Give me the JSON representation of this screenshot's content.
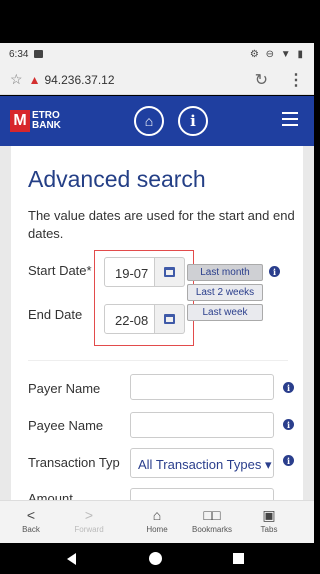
{
  "status": {
    "time": "6:34",
    "icons": "⚙ ⊖ ▼ ▮"
  },
  "browser": {
    "url": "94.236.37.12"
  },
  "header": {
    "logo_mark": "M",
    "logo_line1": "ETRO",
    "logo_line2": "BANK",
    "info_glyph": "i"
  },
  "page": {
    "title": "Advanced search",
    "description": "The value dates are used for the start and end dates."
  },
  "dates": {
    "start_label": "Start Date*",
    "start_value": "19-07",
    "end_label": "End Date",
    "end_value": "22-08",
    "quick": [
      "Last month",
      "Last 2 weeks",
      "Last week"
    ]
  },
  "fields": {
    "payer_label": "Payer Name",
    "payee_label": "Payee Name",
    "type_label": "Transaction Typ",
    "type_value": "All Transaction Types",
    "next_label": "Amount"
  },
  "bottom_nav": [
    {
      "label": "Back",
      "glyph": "<"
    },
    {
      "label": "Forward",
      "glyph": ">"
    },
    {
      "label": "Home",
      "glyph": "⌂"
    },
    {
      "label": "Bookmarks",
      "glyph": "□□"
    },
    {
      "label": "Tabs",
      "glyph": "▣"
    }
  ],
  "colors": {
    "brand_blue": "#1f3fa0",
    "brand_red": "#d7262c",
    "highlight_red": "#e24b4b"
  }
}
